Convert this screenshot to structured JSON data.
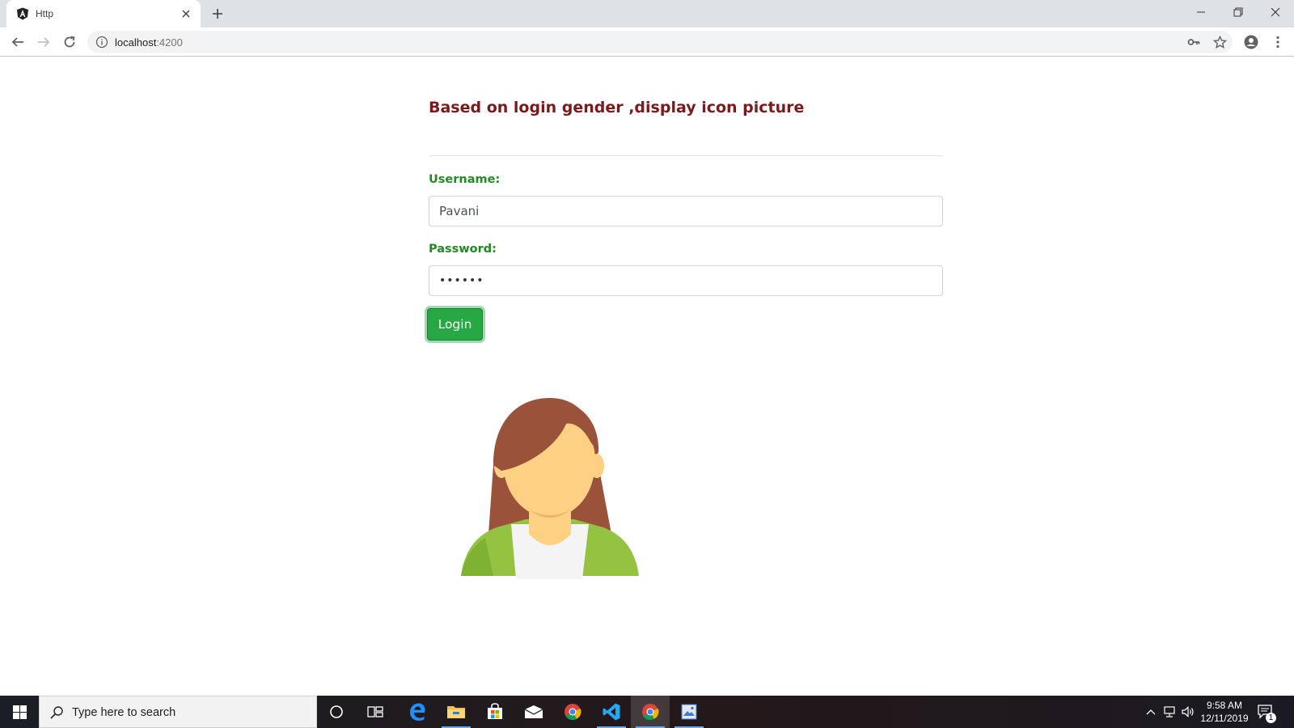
{
  "browser": {
    "tab_title": "Http",
    "url_host": "localhost",
    "url_port": ":4200"
  },
  "page": {
    "heading": "Based on login gender ,display icon picture",
    "username_label": "Username:",
    "username_value": "Pavani",
    "password_label": "Password:",
    "password_masked": "••••••",
    "login_button": "Login",
    "avatar_icon": "female-avatar-icon"
  },
  "taskbar": {
    "search_placeholder": "Type here to search",
    "time": "9:58 AM",
    "date": "12/11/2019",
    "notification_count": "1"
  },
  "colors": {
    "heading": "#7b1a1a",
    "label": "#228b22",
    "button": "#28a745"
  }
}
